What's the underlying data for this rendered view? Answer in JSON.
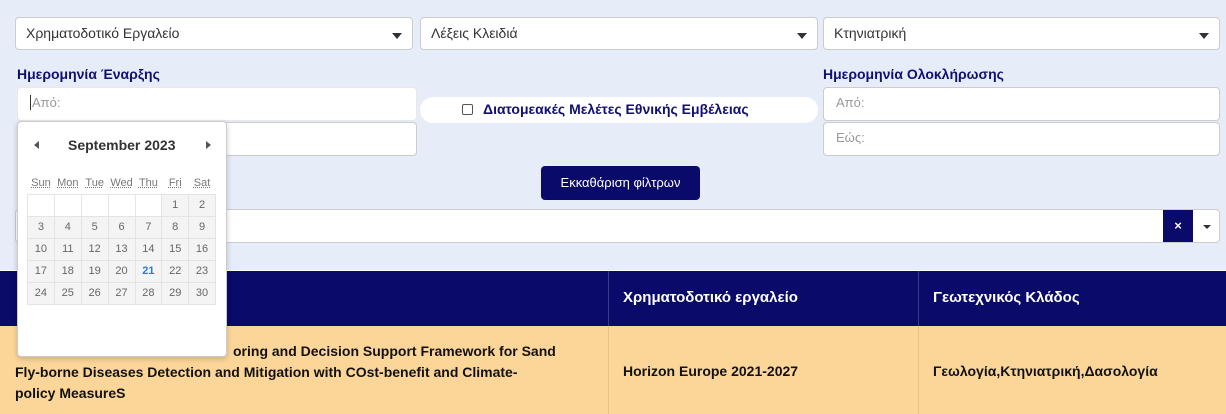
{
  "filters": {
    "funding_tool_select": "Χρηματοδοτικό Εργαλείο",
    "keywords_select": "Λέξεις Κλειδιά",
    "sector_select": "Κτηνιατρική",
    "start_date_label": "Ημερομηνία Έναρξης",
    "start_from_placeholder": "Από:",
    "end_date_label": "Ημερομηνία Ολοκλήρωσης",
    "end_from_placeholder": "Από:",
    "end_to_placeholder": "Εώς:",
    "checkbox_label": "Διατομεακές Μελέτες Εθνικής Εμβέλειας",
    "clear_button": "Εκκαθάριση φίλτρων",
    "clear_x": "×"
  },
  "calendar": {
    "month": "September",
    "year": "2023",
    "weekdays": [
      "Sun",
      "Mon",
      "Tue",
      "Wed",
      "Thu",
      "Fri",
      "Sat"
    ],
    "weeks": [
      [
        "",
        "",
        "",
        "",
        "",
        "1",
        "2"
      ],
      [
        "3",
        "4",
        "5",
        "6",
        "7",
        "8",
        "9"
      ],
      [
        "10",
        "11",
        "12",
        "13",
        "14",
        "15",
        "16"
      ],
      [
        "17",
        "18",
        "19",
        "20",
        "21",
        "22",
        "23"
      ],
      [
        "24",
        "25",
        "26",
        "27",
        "28",
        "29",
        "30"
      ]
    ],
    "today": "21"
  },
  "table": {
    "headers": [
      "Χρηματοδοτικό εργαλείο",
      "Γεωτεχνικός Κλάδος"
    ],
    "row": {
      "title_line1": "oring and Decision Support Framework for Sand",
      "title_line2": "Fly-borne Diseases Detection and Mitigation with COst-benefit and Climate-",
      "title_line3": "policy MeasureS",
      "funding": "Horizon Europe 2021-2027",
      "sector": "Γεωλογία,Κτηνιατρική,Δασολογία"
    }
  }
}
